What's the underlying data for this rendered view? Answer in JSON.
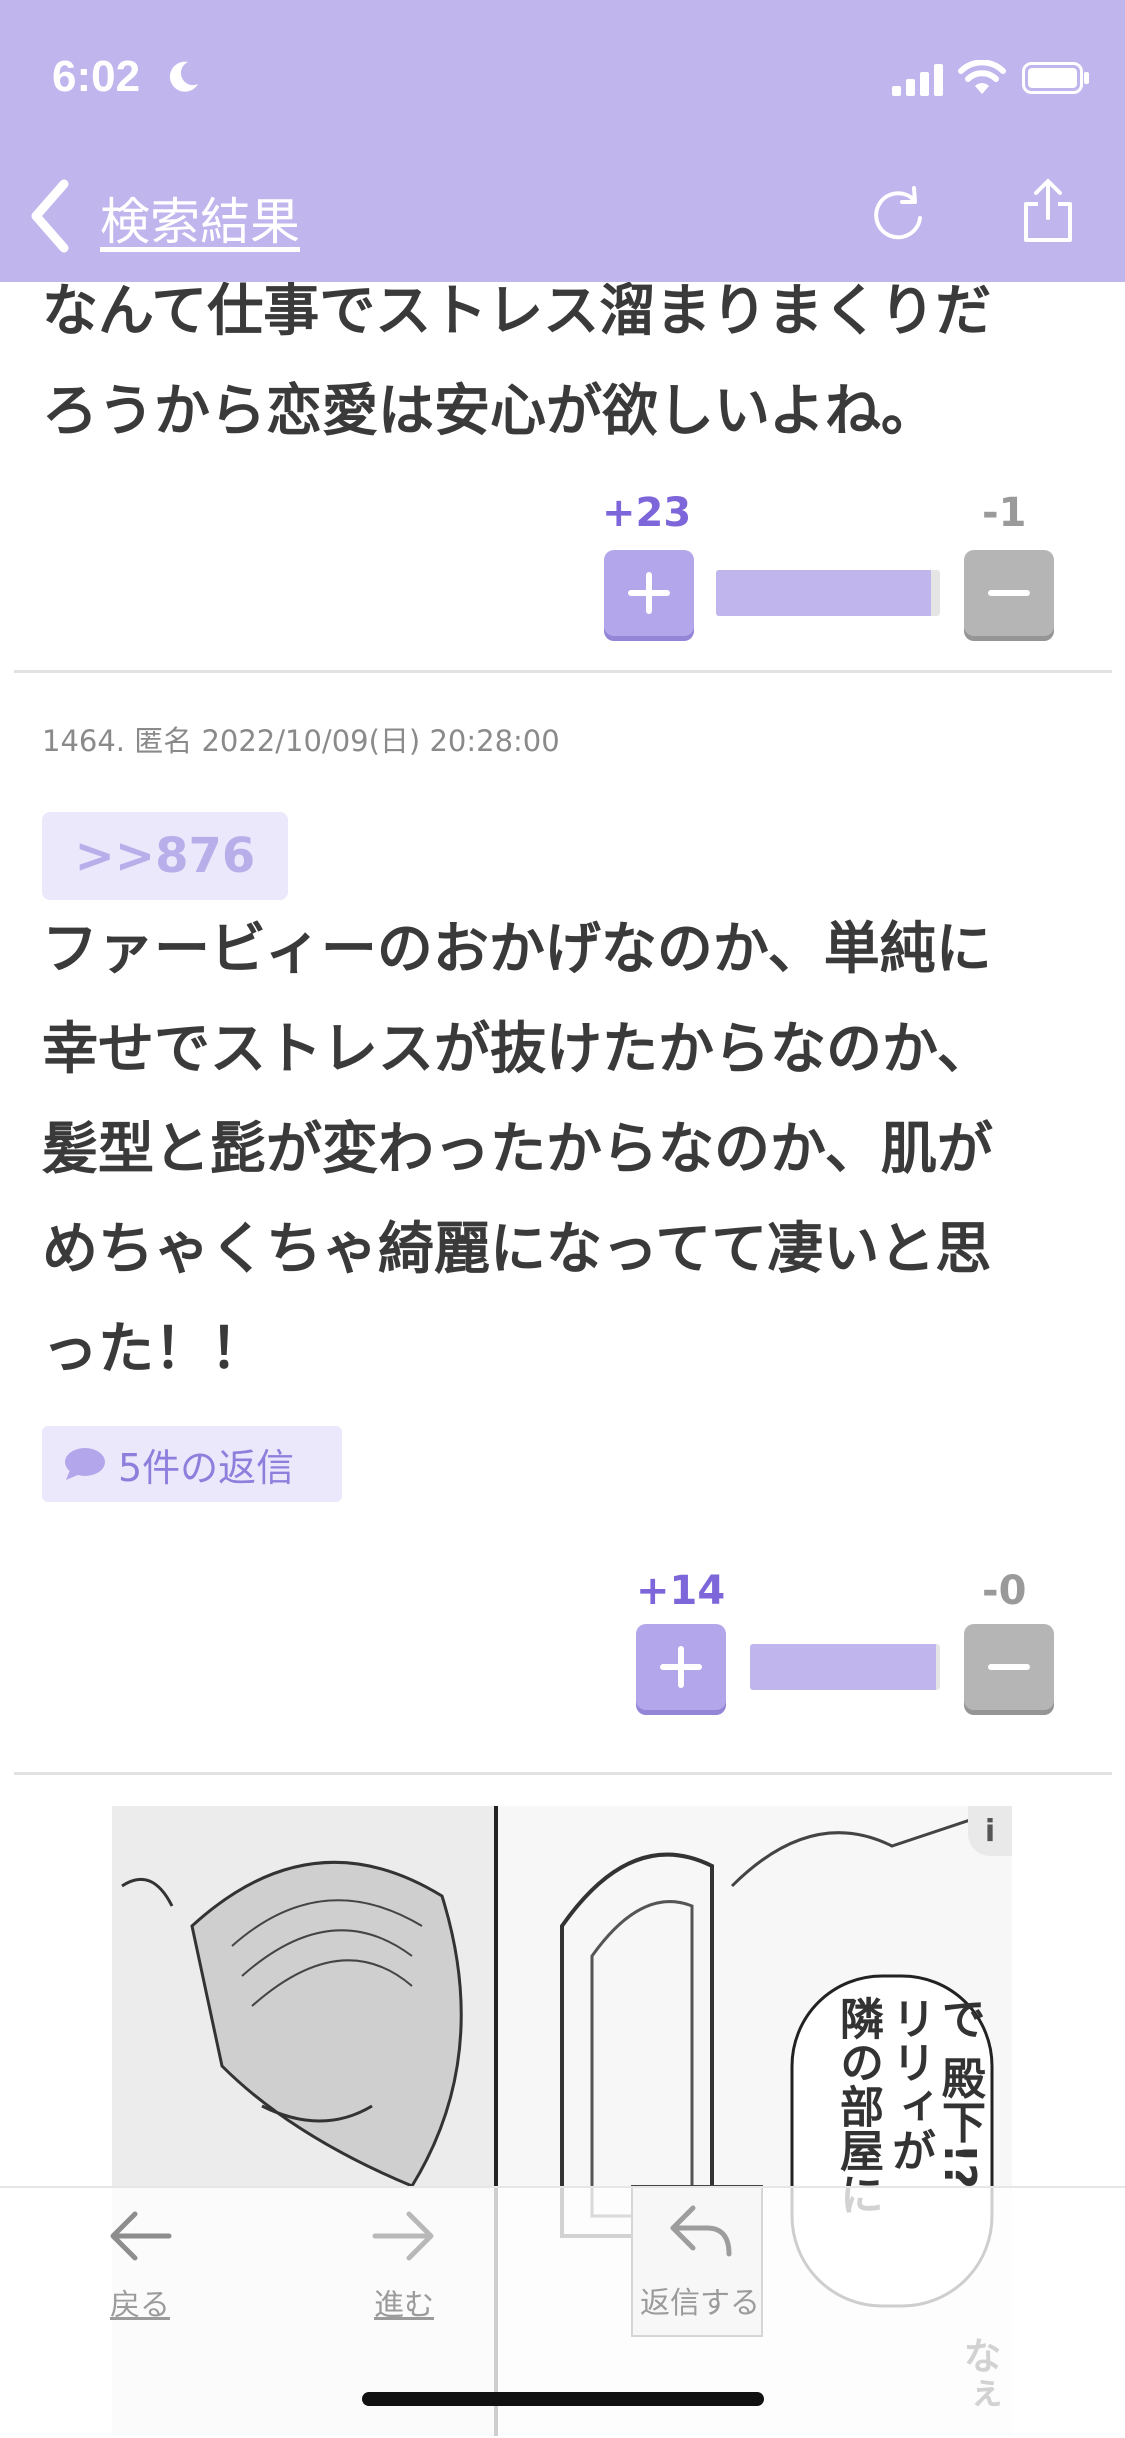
{
  "status_bar": {
    "time": "6:02"
  },
  "nav": {
    "back_label": "検索結果"
  },
  "post_top": {
    "text": "なんて仕事でストレス溜まりまくりだ\nろうから恋愛は安心が欲しいよね。",
    "votes": {
      "plus": "+23",
      "minus": "-1",
      "plus_fraction": 0.96
    }
  },
  "post_1464": {
    "meta": "1464. 匿名 2022/10/09(日) 20:28:00",
    "anchor": ">>876",
    "text": "ファービィーのおかげなのか、単純に\n幸せでストレスが抜けたからなのか、\n髪型と髭が変わったからなのか、肌が\nめちゃくちゃ綺麗になってて凄いと思\nった！！",
    "replies": "5件の返信",
    "votes": {
      "plus": "+14",
      "minus": "-0",
      "plus_fraction": 0.98
    }
  },
  "ad": {
    "info": "i",
    "text_right": "で 殿下!?",
    "text_mid": "リリィが",
    "text_left": "隣の部屋に",
    "text_bottom": "なぇ"
  },
  "toolbar": {
    "back": "戻る",
    "forward": "進む",
    "reply": "返信する"
  },
  "colors": {
    "accent": "#c0b5ec",
    "vote_plus": "#7d66d9",
    "vote_minus": "#9a9a9a"
  }
}
